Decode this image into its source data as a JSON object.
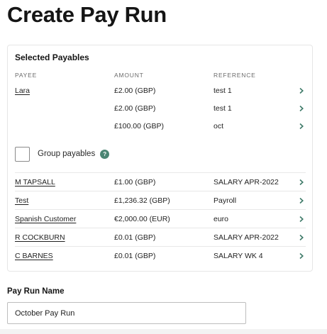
{
  "page": {
    "title": "Create Pay Run"
  },
  "payables": {
    "title": "Selected Payables",
    "columns": {
      "payee": "PAYEE",
      "amount": "AMOUNT",
      "reference": "REFERENCE"
    },
    "grouped_rows": [
      {
        "payee": "Lara",
        "amount": "£2.00 (GBP)",
        "reference": "test 1"
      },
      {
        "payee": "",
        "amount": "£2.00 (GBP)",
        "reference": "test 1"
      },
      {
        "payee": "",
        "amount": "£100.00 (GBP)",
        "reference": "oct"
      }
    ],
    "group_toggle": {
      "label": "Group payables",
      "help": "?",
      "checked": false
    },
    "rows": [
      {
        "payee": "M TAPSALL",
        "amount": "£1.00 (GBP)",
        "reference": "SALARY APR-2022"
      },
      {
        "payee": "Test",
        "amount": "£1,236.32 (GBP)",
        "reference": "Payroll"
      },
      {
        "payee": "Spanish Customer",
        "amount": "€2,000.00 (EUR)",
        "reference": "euro"
      },
      {
        "payee": "R COCKBURN",
        "amount": "£0.01 (GBP)",
        "reference": "SALARY APR-2022"
      },
      {
        "payee": "C BARNES",
        "amount": "£0.01 (GBP)",
        "reference": "SALARY WK 4"
      }
    ]
  },
  "pay_run_name": {
    "label": "Pay Run Name",
    "value": "October Pay Run"
  },
  "colors": {
    "accent": "#3e7a68",
    "help_badge": "#4b8573"
  },
  "icons": {
    "row_action": "chevron-right-icon",
    "help": "help-icon"
  }
}
